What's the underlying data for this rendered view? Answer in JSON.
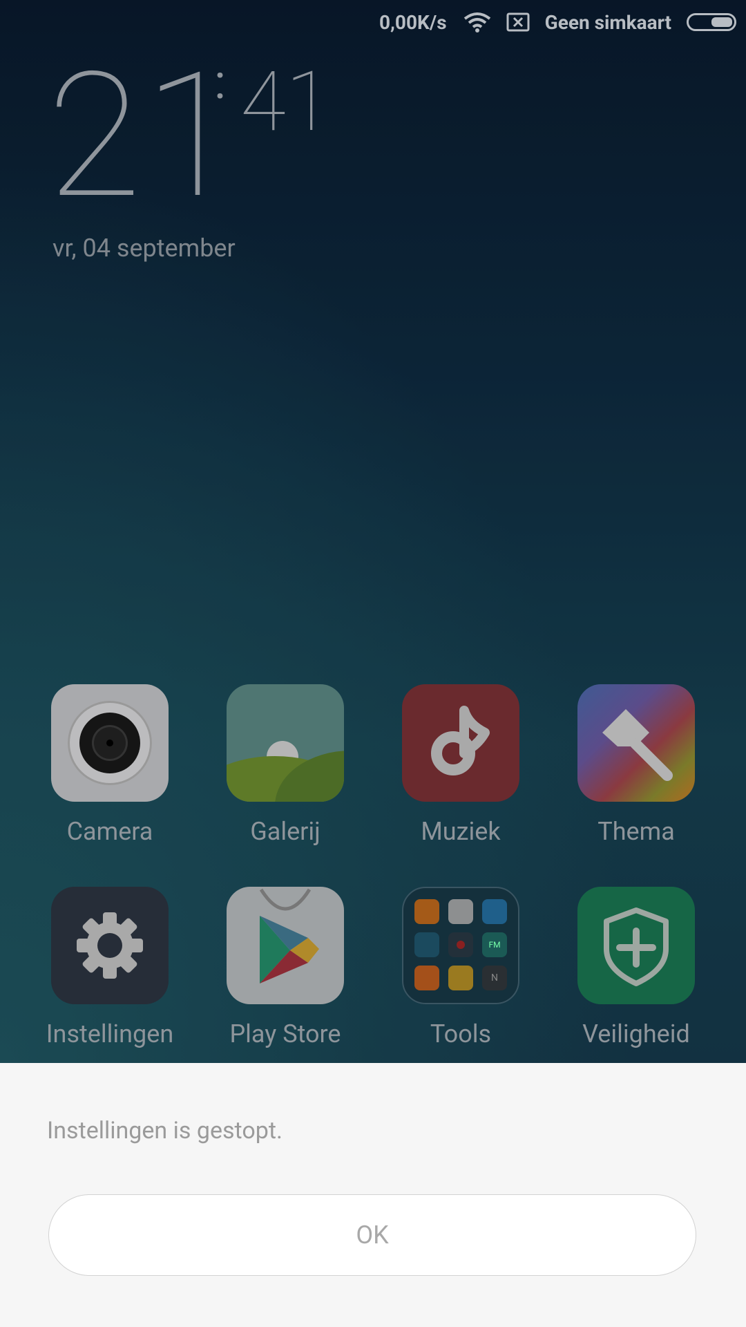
{
  "status_bar": {
    "net_speed": "0,00K/s",
    "sim_status": "Geen simkaart",
    "icons": [
      "wifi-icon",
      "no-sim-icon",
      "battery-icon"
    ]
  },
  "lock_clock": {
    "hours": "21",
    "colon": ":",
    "minutes": "41",
    "date": "vr, 04 september"
  },
  "apps": [
    {
      "label": "Camera",
      "icon": "camera-icon"
    },
    {
      "label": "Galerij",
      "icon": "gallery-icon"
    },
    {
      "label": "Muziek",
      "icon": "music-icon"
    },
    {
      "label": "Thema",
      "icon": "theme-brush-icon"
    },
    {
      "label": "Instellingen",
      "icon": "settings-gear-icon"
    },
    {
      "label": "Play Store",
      "icon": "play-store-icon"
    },
    {
      "label": "Tools",
      "icon": "tools-folder-icon"
    },
    {
      "label": "Veiligheid",
      "icon": "security-shield-icon"
    }
  ],
  "tools_folder_labels": {
    "fm": "FM",
    "n": "N"
  },
  "dialog": {
    "message": "Instellingen is gestopt.",
    "ok_label": "OK"
  }
}
